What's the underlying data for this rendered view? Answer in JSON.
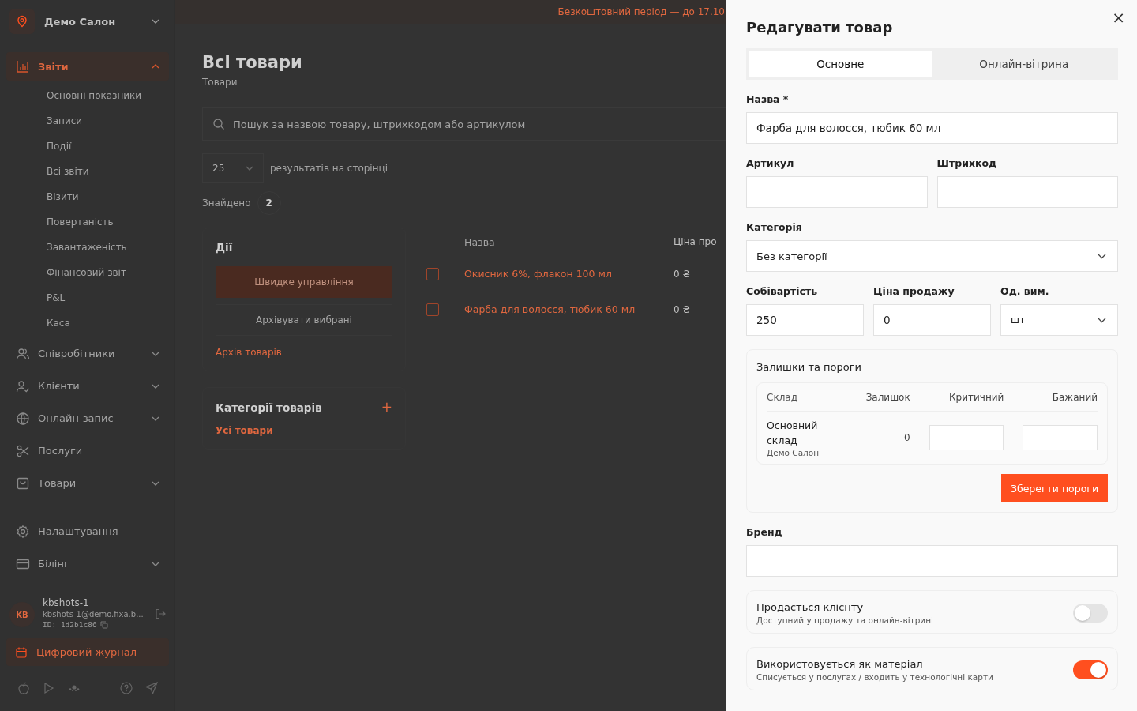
{
  "sidebar": {
    "salon": "Демо Салон",
    "nav": [
      {
        "label": "Звіти",
        "selected": true,
        "expanded": true,
        "children": [
          {
            "label": "Основні показники"
          },
          {
            "label": "Записи"
          },
          {
            "label": "Події"
          },
          {
            "label": "Всі звіти"
          },
          {
            "label": "Візити"
          },
          {
            "label": "Повертаність"
          },
          {
            "label": "Завантаженість"
          },
          {
            "label": "Фінансовий звіт"
          },
          {
            "label": "P&L"
          },
          {
            "label": "Каса"
          }
        ]
      },
      {
        "label": "Співробітники",
        "selected": false,
        "expanded": false
      },
      {
        "label": "Клієнти",
        "selected": false,
        "expanded": false
      },
      {
        "label": "Онлайн-запис",
        "selected": false,
        "expanded": false
      },
      {
        "label": "Послуги",
        "selected": false
      },
      {
        "label": "Товари",
        "selected": false,
        "expanded": false
      }
    ],
    "nav_bottom": [
      {
        "label": "Налаштування",
        "selected": false
      },
      {
        "label": "Білінг",
        "selected": false,
        "expanded": false
      }
    ],
    "user": {
      "initials": "KB",
      "name": "kbshots-1",
      "email": "kbshots-1@demo.fixa.b...",
      "id": "ID: 1d2b1c86"
    },
    "journal": "Цифровий журнал"
  },
  "banner": "Безкоштовний період — до 17.10",
  "page": {
    "title": "Всі товари",
    "breadcrumb": "Товари",
    "search": {
      "placeholder": "Пошук за назвою товару, штрихкодом або артикулом"
    },
    "per_page": "25",
    "per_page_label": "результатів на сторінці",
    "found_label": "Знайдено",
    "found_count": "2"
  },
  "actions": {
    "title": "Дії",
    "buttons": [
      "Швидке управління",
      "Архівувати вибрані"
    ],
    "archive_link": "Архів товарів"
  },
  "categories": {
    "title": "Категорії товарів",
    "add": "+",
    "items": [
      {
        "label": "Усі товари",
        "selected": true
      }
    ]
  },
  "table": {
    "columns": [
      "Назва",
      "Ціна про"
    ],
    "rows": [
      {
        "checked": false,
        "name": "Окисник 6%, флакон 100 мл",
        "price": "0 ₴"
      },
      {
        "checked": false,
        "name": "Фарба для волосся, тюбик 60 мл",
        "price": "0 ₴"
      }
    ]
  },
  "drawer": {
    "title": "Редагувати товар",
    "close": "×",
    "tabs": [
      {
        "label": "Основне",
        "selected": true
      },
      {
        "label": "Онлайн-вітрина",
        "selected": false
      }
    ],
    "name": {
      "label": "Назва *",
      "value": "Фарба для волосся, тюбик 60 мл"
    },
    "article": {
      "label": "Артикул"
    },
    "barcode": {
      "label": "Штрихкод"
    },
    "category": {
      "label": "Категорія",
      "value": "Без категорії"
    },
    "cost": {
      "label": "Собівартість",
      "value": "250"
    },
    "price": {
      "label": "Ціна продажу",
      "value": "0"
    },
    "unit": {
      "label": "Од. вим.",
      "value": "шт"
    },
    "stock": {
      "title": "Залишки та пороги",
      "columns": [
        "Склад",
        "Залишок",
        "Критичний",
        "Бажаний"
      ],
      "rows": [
        {
          "warehouse": "Основний склад",
          "salon": "Демо Салон",
          "balance": "0"
        }
      ],
      "save": "Зберегти пороги"
    },
    "brand": {
      "label": "Бренд"
    },
    "toggles": [
      {
        "title": "Продається клієнту",
        "hint": "Доступний у продажу та онлайн-вітрині",
        "on": false
      },
      {
        "title": "Використовується як матеріал",
        "hint": "Списується у послугах / входить у технологічні карти",
        "on": true
      }
    ]
  }
}
